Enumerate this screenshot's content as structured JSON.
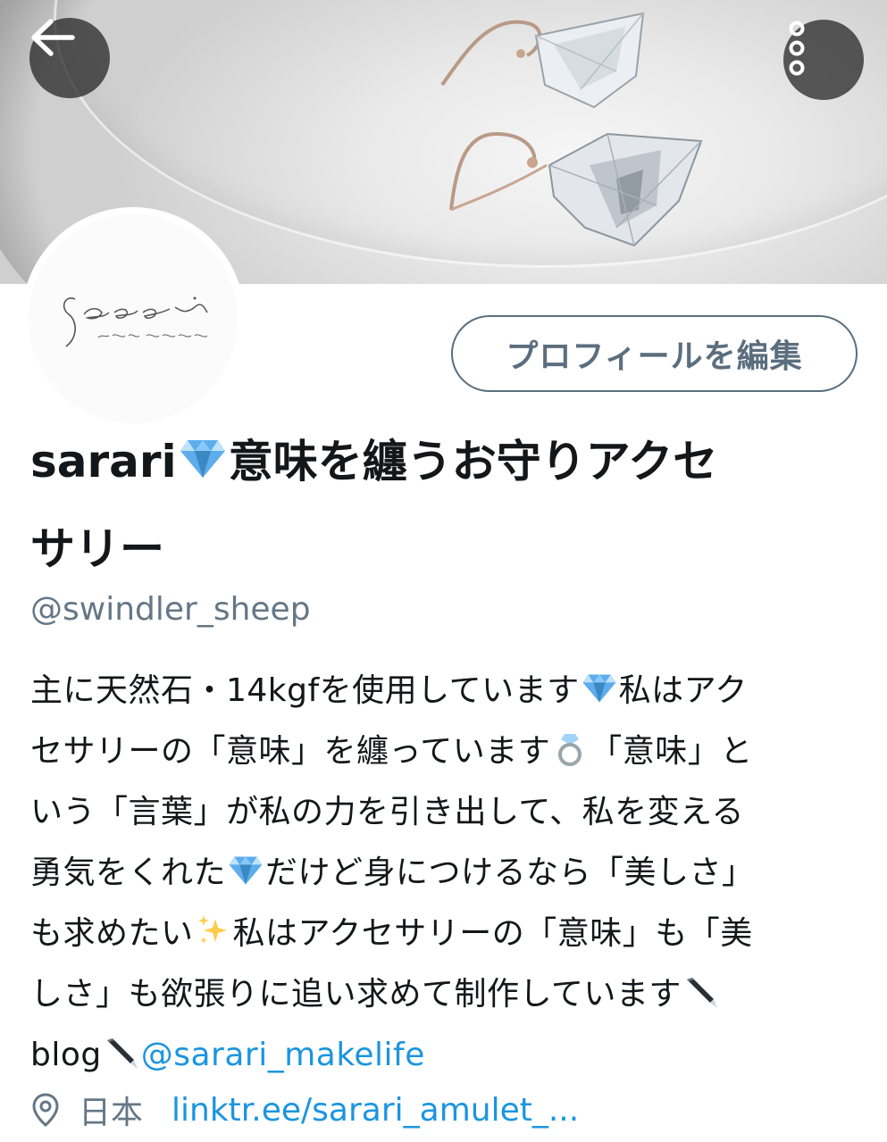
{
  "header": {
    "back_icon": "arrow-left-icon",
    "more_icon": "more-vertical-icon"
  },
  "avatar": {
    "logo_text": "Sarari",
    "logo_subtext": "amulet accessory"
  },
  "profile": {
    "edit_button_label": "プロフィールを編集",
    "name_prefix": "sarari",
    "name_rest_line1": "意味を纏うお守りアクセ",
    "name_rest_line2": "サリー",
    "handle": "@swindler_sheep"
  },
  "bio": {
    "p1": "主に天然石・14kgfを使用しています",
    "p2": "私はアク",
    "p3": "セサリーの「意味」を纏っています",
    "p4": "「意味」と",
    "p5": "いう「言葉」が私の力を引き出して、私を変える",
    "p6": "勇気をくれた",
    "p7": "だけど身につけるなら「美しさ」",
    "p8": "も求めたい",
    "p9": "私はアクセサリーの「意味」も「美",
    "p10": "しさ」も欲張りに追い求めて制作しています",
    "p11": "blog",
    "blog_link": "@sarari_makelife"
  },
  "meta": {
    "location_icon": "location-pin-icon",
    "location": "日本",
    "url": "linktr.ee/sarari_amulet_..."
  },
  "colors": {
    "link": "#1b95e0",
    "secondary_text": "#657786",
    "primary_text": "#14171a",
    "button_border": "#5b6e7e"
  }
}
